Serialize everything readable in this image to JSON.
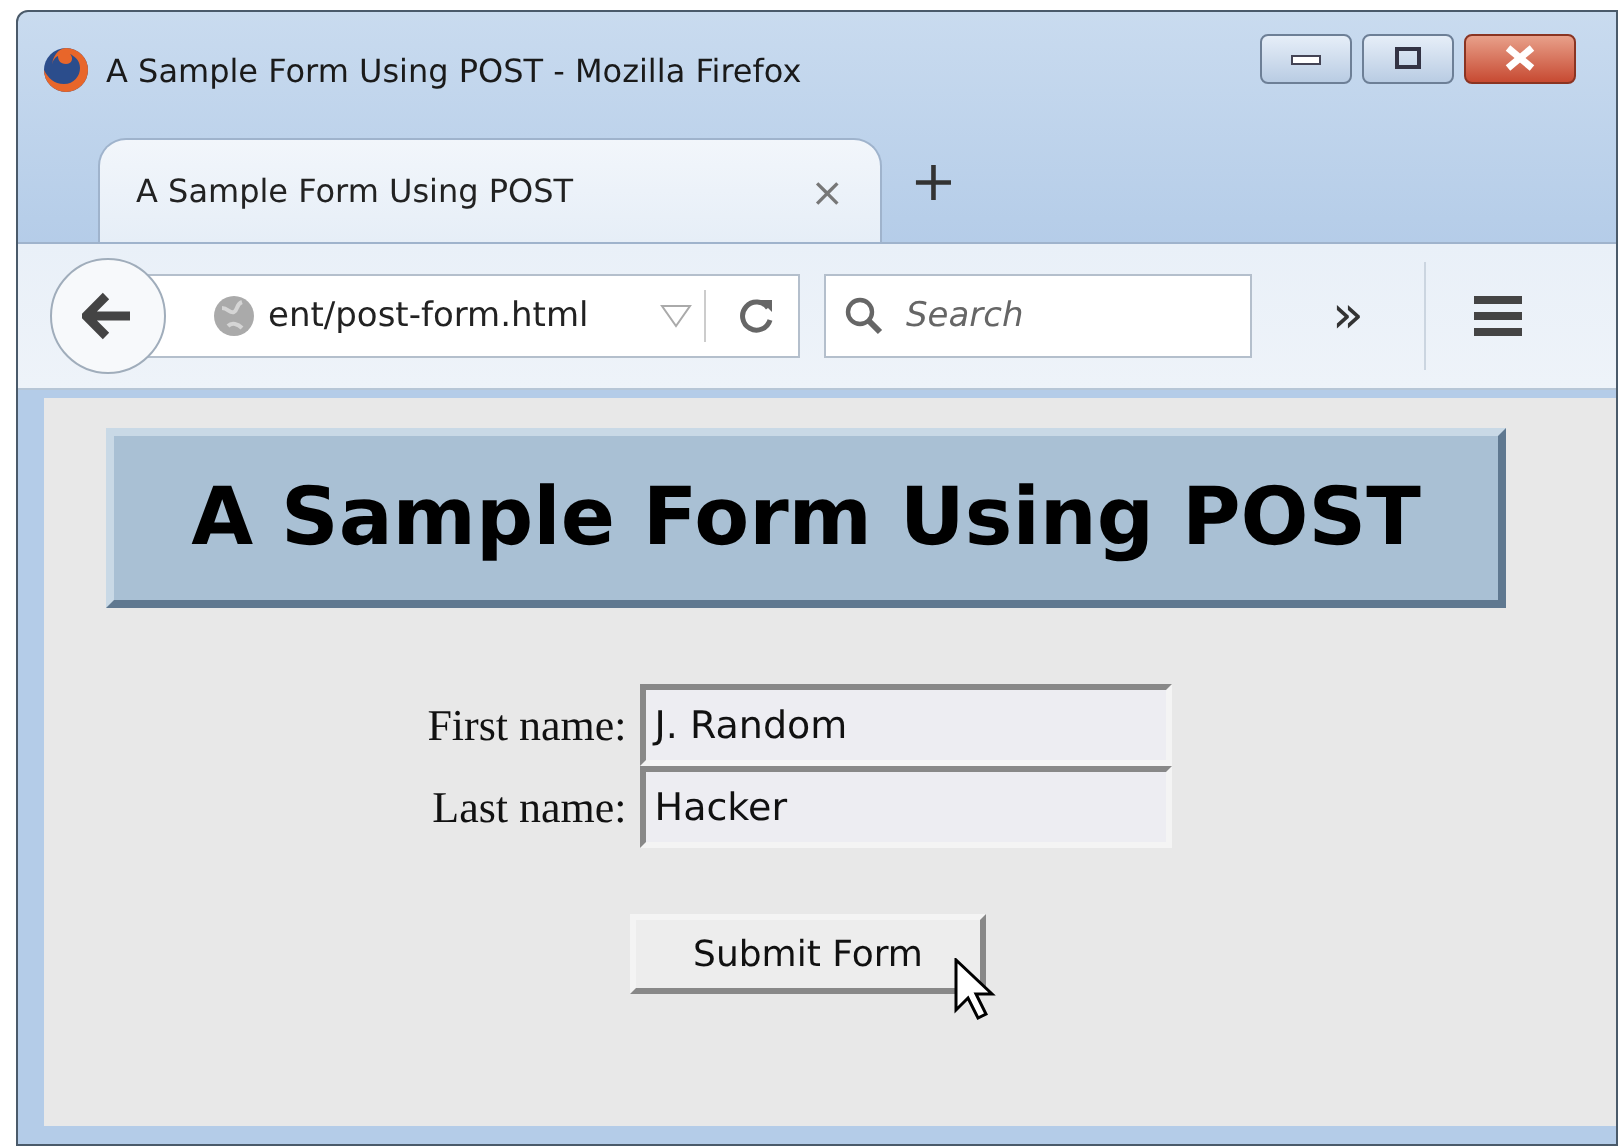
{
  "window": {
    "title": "A Sample Form Using POST - Mozilla Firefox"
  },
  "tabs": [
    {
      "label": "A Sample Form Using POST",
      "selected": true,
      "close": "×"
    }
  ],
  "new_tab": "+",
  "toolbar": {
    "url": "ent/post-form.html",
    "search": {
      "placeholder": "Search"
    },
    "overflow": "»"
  },
  "page": {
    "heading": "A Sample Form Using POST",
    "fields": [
      {
        "label": "First name:",
        "value": "J. Random"
      },
      {
        "label": "Last name:",
        "value": "Hacker"
      }
    ],
    "submit": "Submit Form"
  }
}
